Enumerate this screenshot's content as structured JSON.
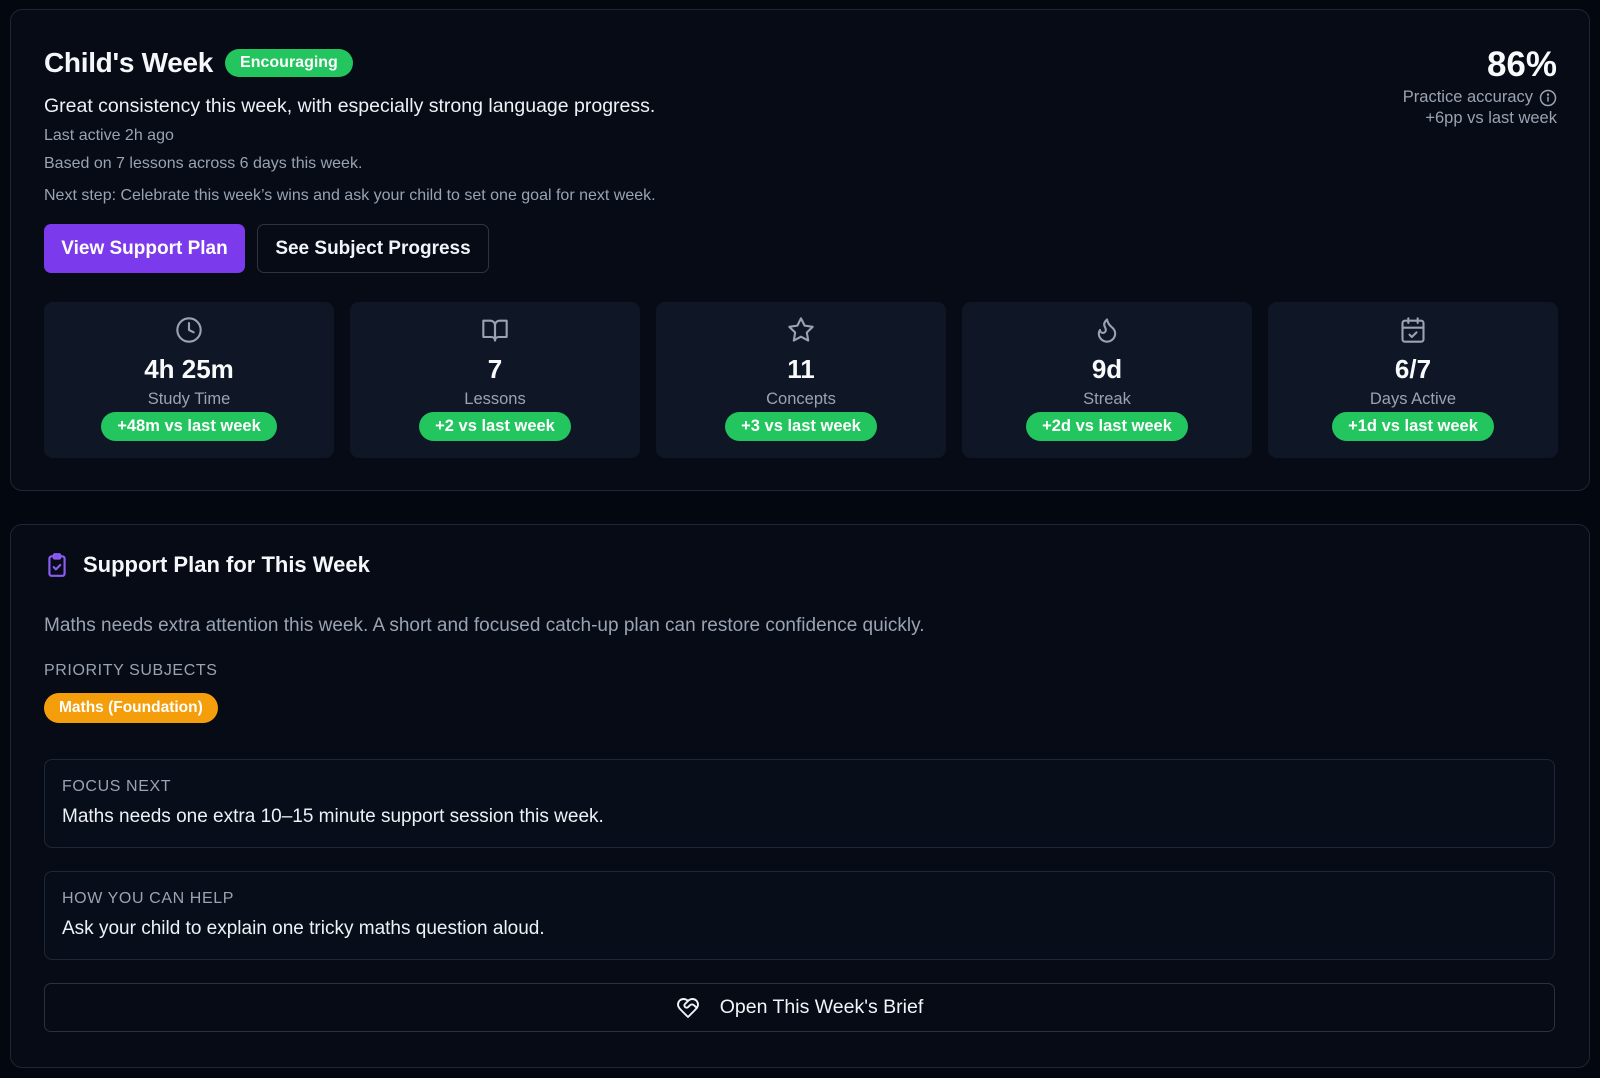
{
  "week": {
    "title": "Child's Week",
    "tone_badge": "Encouraging",
    "summary": "Great consistency this week, with especially strong language progress.",
    "last_active": "Last active 2h ago",
    "based_on": "Based on 7 lessons across 6 days this week.",
    "next_step": "Next step: Celebrate this week’s wins and ask your child to set one goal for next week.",
    "view_plan_label": "View Support Plan",
    "subject_progress_label": "See Subject Progress",
    "accuracy": {
      "value": "86%",
      "label": "Practice accuracy",
      "delta": "+6pp vs last week"
    },
    "stats": [
      {
        "icon": "clock-icon",
        "value": "4h 25m",
        "label": "Study Time",
        "delta": "+48m vs last week"
      },
      {
        "icon": "book-open-icon",
        "value": "7",
        "label": "Lessons",
        "delta": "+2 vs last week"
      },
      {
        "icon": "star-icon",
        "value": "11",
        "label": "Concepts",
        "delta": "+3 vs last week"
      },
      {
        "icon": "flame-icon",
        "value": "9d",
        "label": "Streak",
        "delta": "+2d vs last week"
      },
      {
        "icon": "calendar-check-icon",
        "value": "6/7",
        "label": "Days Active",
        "delta": "+1d vs last week"
      }
    ]
  },
  "plan": {
    "icon": "clipboard-check-icon",
    "title": "Support Plan for This Week",
    "description": "Maths needs extra attention this week. A short and focused catch-up plan can restore confidence quickly.",
    "priority_label": "PRIORITY SUBJECTS",
    "priority_subjects": [
      "Maths (Foundation)"
    ],
    "focus_label": "FOCUS NEXT",
    "focus_text": "Maths needs one extra 10–15 minute support session this week.",
    "help_label": "HOW YOU CAN HELP",
    "help_text": "Ask your child to explain one tricky maths question aloud.",
    "brief_label": "Open This Week's Brief",
    "brief_icon": "heart-handshake-icon"
  },
  "colors": {
    "background": "#03070f",
    "card": "#060b16",
    "stat_tile": "#0f1726",
    "accent_purple": "#7c3aed",
    "success_green": "#22c55e",
    "warning_amber": "#f59e0b",
    "muted_text": "#9aa3b2"
  }
}
